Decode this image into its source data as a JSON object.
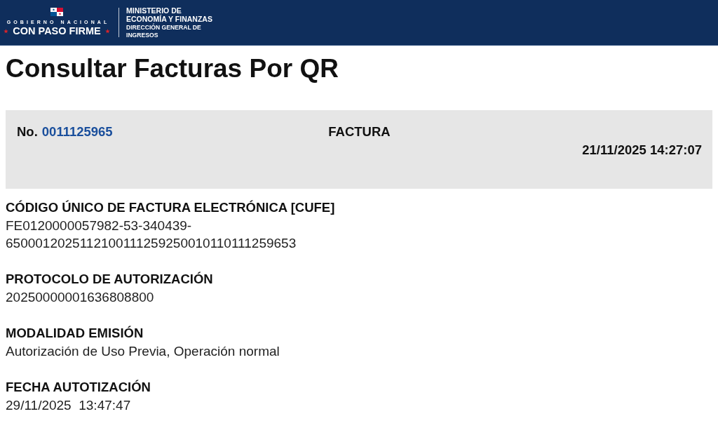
{
  "header": {
    "logo": {
      "tagline_top": "GOBIERNO NACIONAL",
      "tagline": "CON PASO FIRME"
    },
    "agency": {
      "lines": [
        "MINISTERIO DE",
        "ECONOMÍA Y FINANZAS"
      ],
      "sub_lines": [
        "DIRECCIÓN GENERAL DE",
        "INGRESOS"
      ]
    }
  },
  "page_title": "Consultar Facturas Por QR",
  "invoice_summary": {
    "number_label": "No.",
    "number": "0011125965",
    "document_type": "FACTURA",
    "issued_at": "21/11/2025 14:27:07"
  },
  "fields": [
    {
      "label": "CÓDIGO ÚNICO DE FACTURA ELECTRÓNICA [CUFE]",
      "value_lines": [
        "FE0120000057982-53-340439-",
        "6500012025112100111259250010110111259653"
      ]
    },
    {
      "label": "PROTOCOLO DE AUTORIZACIÓN",
      "value_lines": [
        "20250000001636808800"
      ]
    },
    {
      "label": "MODALIDAD EMISIÓN",
      "value_lines": [
        "Autorización de Uso Previa, Operación normal"
      ]
    },
    {
      "label": "FECHA AUTOTIZACIÓN",
      "value_lines": [
        "29/11/2025  13:47:47"
      ]
    }
  ]
}
